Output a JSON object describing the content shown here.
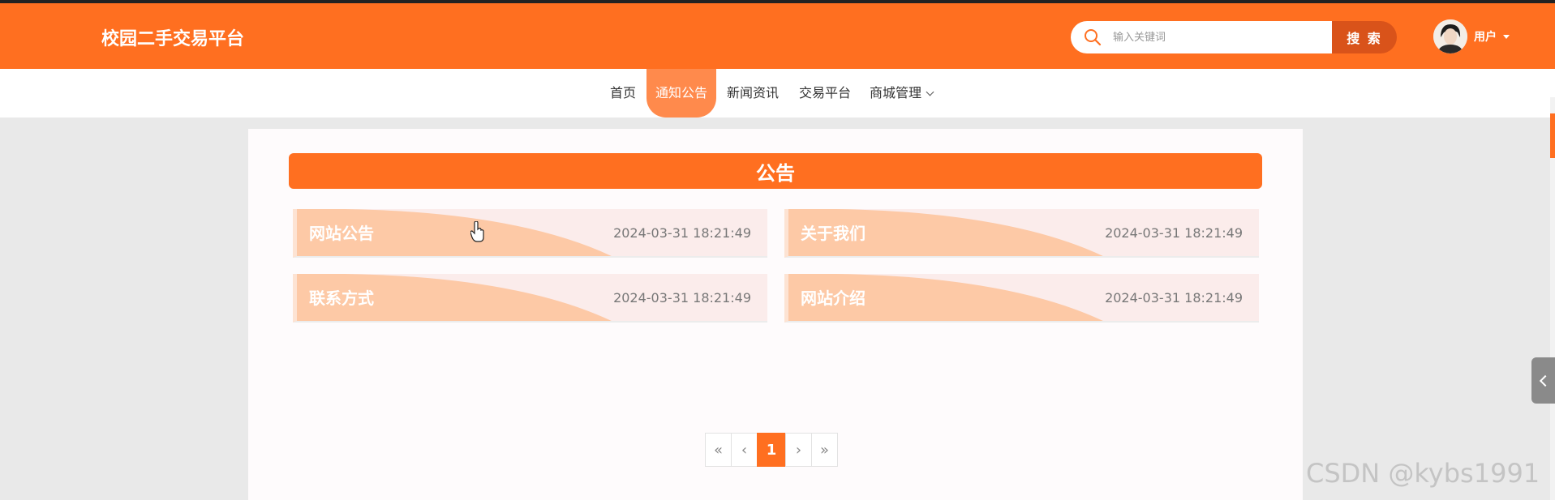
{
  "header": {
    "site_title": "校园二手交易平台",
    "search": {
      "placeholder": "输入关键词",
      "button_label": "搜 索"
    },
    "user": {
      "label": "用户"
    }
  },
  "nav": {
    "items": [
      {
        "label": "首页"
      },
      {
        "label": "通知公告",
        "active": true
      },
      {
        "label": "新闻资讯"
      },
      {
        "label": "交易平台"
      },
      {
        "label": "商城管理"
      }
    ]
  },
  "main": {
    "section_title": "公告",
    "notices": [
      {
        "title": "网站公告",
        "date": "2024-03-31 18:21:49"
      },
      {
        "title": "关于我们",
        "date": "2024-03-31 18:21:49"
      },
      {
        "title": "联系方式",
        "date": "2024-03-31 18:21:49"
      },
      {
        "title": "网站介绍",
        "date": "2024-03-31 18:21:49"
      }
    ],
    "pagination": {
      "first": "«",
      "prev": "‹",
      "current": "1",
      "next": "›",
      "last": "»"
    }
  },
  "watermark": "CSDN @kybs1991",
  "colors": {
    "primary": "#ff6f20",
    "search_button": "#d9531a",
    "card_bg": "#fbeceb",
    "card_shape": "#fdc9a6"
  }
}
